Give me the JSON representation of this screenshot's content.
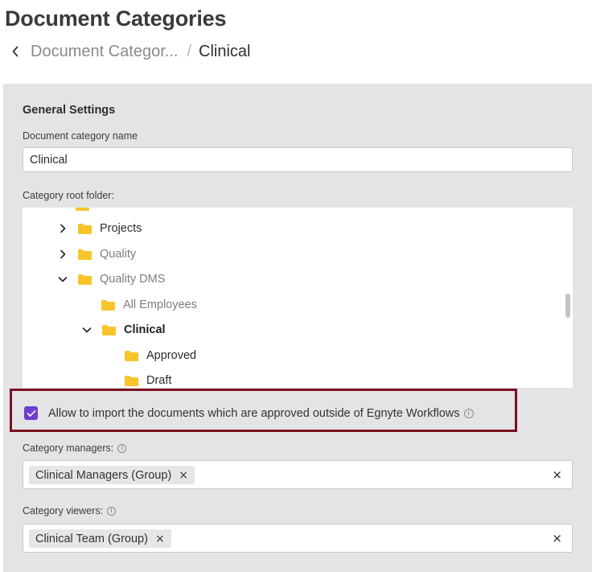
{
  "page": {
    "title": "Document Categories"
  },
  "breadcrumb": {
    "parent": "Document Categor...",
    "separator": "/",
    "current": "Clinical"
  },
  "general": {
    "section_title": "General Settings",
    "name_label": "Document category name",
    "name_value": "Clinical",
    "root_folder_label": "Category root folder:"
  },
  "tree": {
    "items": [
      {
        "label": "Projects",
        "expanded": false,
        "style": "normal",
        "icon": "folder-icon"
      },
      {
        "label": "Quality",
        "expanded": false,
        "style": "dim",
        "icon": "folder-icon"
      },
      {
        "label": "Quality DMS",
        "expanded": true,
        "style": "dim",
        "icon": "folder-icon"
      },
      {
        "label": "All Employees",
        "expanded": null,
        "style": "dim",
        "icon": "folder-icon"
      },
      {
        "label": "Clinical",
        "expanded": true,
        "style": "bold",
        "icon": "folder-icon"
      },
      {
        "label": "Approved",
        "expanded": null,
        "style": "normal",
        "icon": "folder-icon"
      },
      {
        "label": "Draft",
        "expanded": null,
        "style": "normal",
        "icon": "folder-icon"
      }
    ]
  },
  "import_option": {
    "label": "Allow to import the documents which are approved outside of Egnyte Workflows",
    "checked": true
  },
  "managers": {
    "label": "Category managers:",
    "chips": [
      "Clinical Managers (Group)"
    ]
  },
  "viewers": {
    "label": "Category viewers:",
    "chips": [
      "Clinical Team (Group)"
    ]
  },
  "icons": {
    "chip_remove": "×",
    "clear_all": "×",
    "info": "i"
  },
  "colors": {
    "accent": "#6b3fd0",
    "highlight_border": "#7a1020",
    "folder": "#f7c52b",
    "panel_bg": "#e4e4e7"
  }
}
